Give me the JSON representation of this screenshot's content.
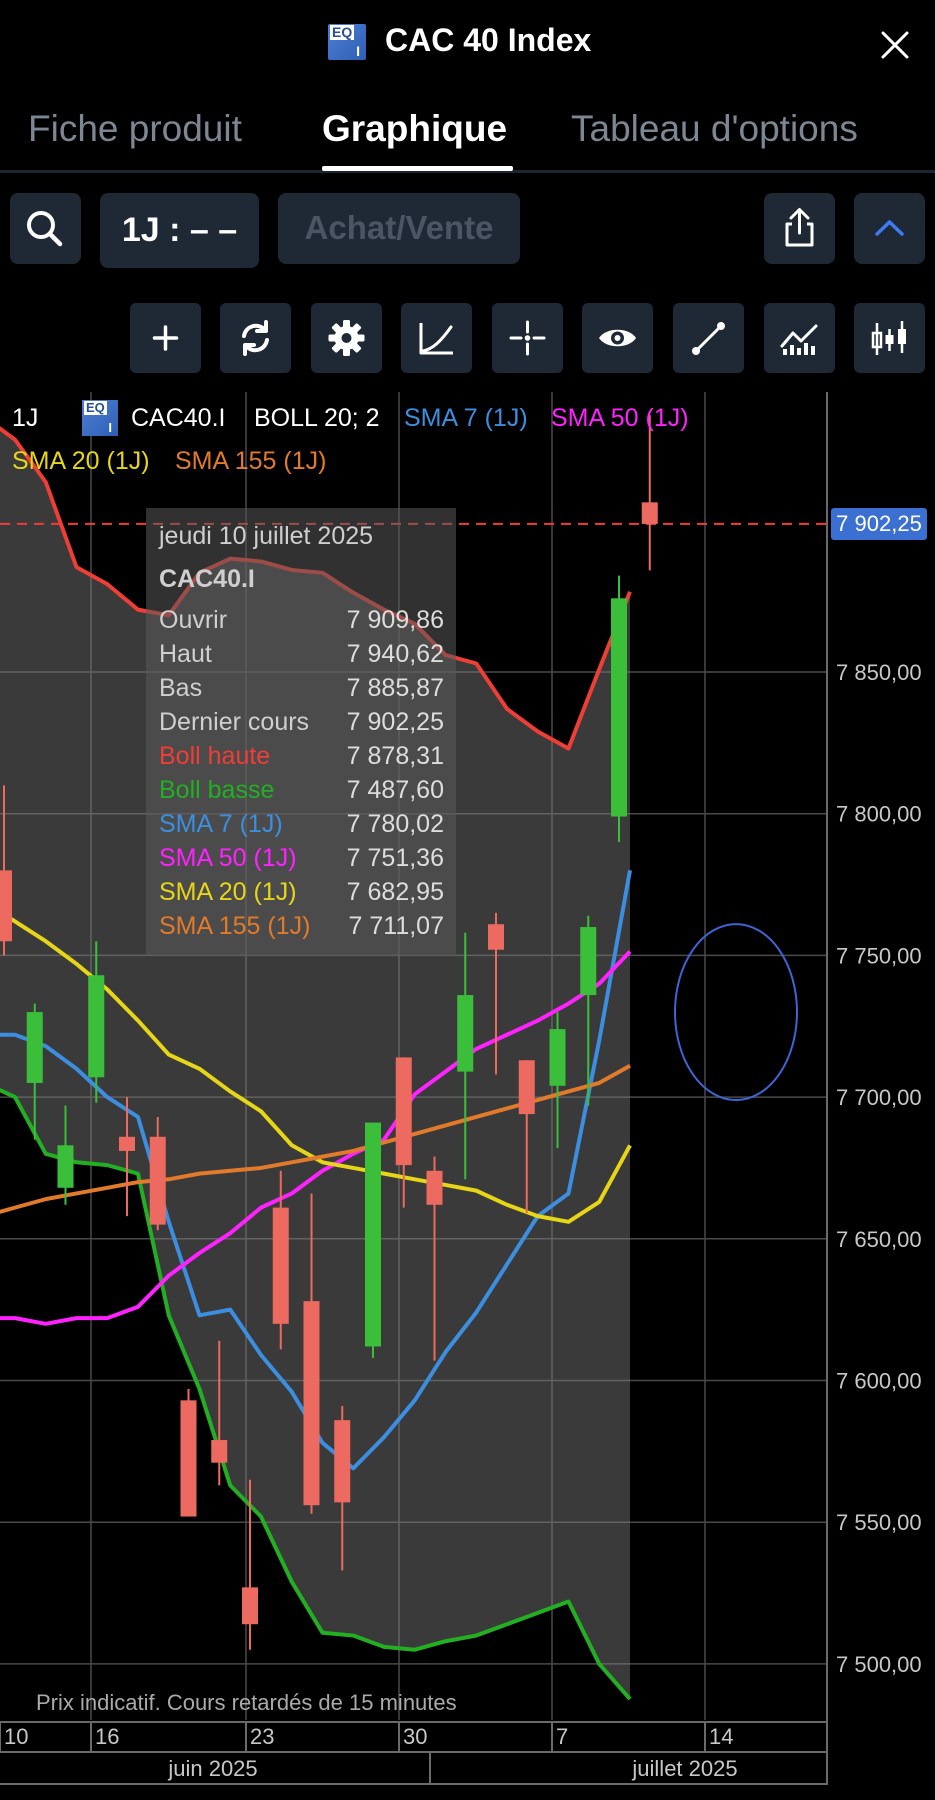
{
  "header": {
    "badge_text": "EQ I",
    "title": "CAC 40 Index"
  },
  "tabs": [
    {
      "label": "Fiche produit",
      "active": false
    },
    {
      "label": "Graphique",
      "active": true
    },
    {
      "label": "Tableau d'options",
      "active": false
    }
  ],
  "toolbar": {
    "period_label": "1J : – –",
    "trade_label": "Achat/Vente"
  },
  "tools": [
    "plus-icon",
    "refresh-icon",
    "settings-icon",
    "curve-icon",
    "crosshair-icon",
    "eye-icon",
    "line-draw-icon",
    "indicators-icon",
    "candlestick-icon"
  ],
  "legend": {
    "period": "1J",
    "symbol": "CAC40.I",
    "boll": "BOLL 20; 2",
    "sma7": "SMA 7 (1J)",
    "sma50": "SMA 50 (1J)",
    "sma20": "SMA 20 (1J)",
    "sma155": "SMA 155 (1J)"
  },
  "tooltip": {
    "date": "jeudi 10 juillet 2025",
    "symbol": "CAC40.I",
    "rows": [
      {
        "label": "Ouvrir",
        "value": "7 909,86",
        "color": "#cfcfcf"
      },
      {
        "label": "Haut",
        "value": "7 940,62",
        "color": "#cfcfcf"
      },
      {
        "label": "Bas",
        "value": "7 885,87",
        "color": "#cfcfcf"
      },
      {
        "label": "Dernier cours",
        "value": "7 902,25",
        "color": "#cfcfcf"
      },
      {
        "label": "Boll haute",
        "value": "7 878,31",
        "color": "#ef3e36"
      },
      {
        "label": "Boll basse",
        "value": "7 487,60",
        "color": "#22b022"
      },
      {
        "label": "SMA 7 (1J)",
        "value": "7 780,02",
        "color": "#3c8ee0"
      },
      {
        "label": "SMA 50 (1J)",
        "value": "7 751,36",
        "color": "#ff22ff"
      },
      {
        "label": "SMA 20 (1J)",
        "value": "7 682,95",
        "color": "#e6d617"
      },
      {
        "label": "SMA 155 (1J)",
        "value": "7 711,07",
        "color": "#e27a2b"
      }
    ]
  },
  "last_price_label": "7 902,25",
  "disclaimer": "Prix indicatif. Cours retardés de 15 minutes",
  "chart_data": {
    "type": "candlestick",
    "ylim": [
      7480,
      7970
    ],
    "y_ticks": [
      7500,
      7550,
      7600,
      7650,
      7700,
      7750,
      7800,
      7850
    ],
    "y_tick_labels": [
      "7 500,00",
      "7 550,00",
      "7 600,00",
      "7 650,00",
      "7 700,00",
      "7 750,00",
      "7 800,00",
      "7 850,00"
    ],
    "x_ticks": [
      {
        "slot": 0,
        "label": "10"
      },
      {
        "slot": 3,
        "label": "16"
      },
      {
        "slot": 8,
        "label": "23"
      },
      {
        "slot": 13,
        "label": "30"
      },
      {
        "slot": 18,
        "label": "7"
      },
      {
        "slot": 23,
        "label": "14"
      }
    ],
    "months": [
      {
        "label": "juin 2025",
        "from_slot": -0.5,
        "to_slot": 13.5
      },
      {
        "label": "juillet 2025",
        "from_slot": 13.5,
        "to_slot": 26.5
      }
    ],
    "candles": [
      {
        "slot": 0,
        "o": 7780,
        "c": 7755,
        "h": 7810,
        "l": 7750
      },
      {
        "slot": 1,
        "o": 7705,
        "c": 7730,
        "h": 7733,
        "l": 7685
      },
      {
        "slot": 2,
        "o": 7668,
        "c": 7683,
        "h": 7697,
        "l": 7662
      },
      {
        "slot": 3,
        "o": 7707,
        "c": 7743,
        "h": 7755,
        "l": 7698
      },
      {
        "slot": 4,
        "o": 7686,
        "c": 7681,
        "h": 7700,
        "l": 7658
      },
      {
        "slot": 5,
        "o": 7686,
        "c": 7655,
        "h": 7693,
        "l": 7653
      },
      {
        "slot": 6,
        "o": 7593,
        "c": 7552,
        "h": 7597,
        "l": 7552
      },
      {
        "slot": 7,
        "o": 7579,
        "c": 7571,
        "h": 7614,
        "l": 7563
      },
      {
        "slot": 8,
        "o": 7527,
        "c": 7514,
        "h": 7565,
        "l": 7505
      },
      {
        "slot": 9,
        "o": 7661,
        "c": 7620,
        "h": 7674,
        "l": 7611
      },
      {
        "slot": 10,
        "o": 7628,
        "c": 7556,
        "h": 7666,
        "l": 7553
      },
      {
        "slot": 11,
        "o": 7586,
        "c": 7557,
        "h": 7591,
        "l": 7533
      },
      {
        "slot": 12,
        "o": 7612,
        "c": 7691,
        "h": 7691,
        "l": 7608
      },
      {
        "slot": 13,
        "o": 7714,
        "c": 7676,
        "h": 7714,
        "l": 7661
      },
      {
        "slot": 14,
        "o": 7674,
        "c": 7662,
        "h": 7679,
        "l": 7607
      },
      {
        "slot": 15,
        "o": 7709,
        "c": 7736,
        "h": 7758,
        "l": 7671
      },
      {
        "slot": 16,
        "o": 7761,
        "c": 7752,
        "h": 7765,
        "l": 7708
      },
      {
        "slot": 17,
        "o": 7713,
        "c": 7694,
        "h": 7713,
        "l": 7659
      },
      {
        "slot": 18,
        "o": 7704,
        "c": 7724,
        "h": 7730,
        "l": 7682
      },
      {
        "slot": 19,
        "o": 7736,
        "c": 7760,
        "h": 7764,
        "l": 7697
      },
      {
        "slot": 20,
        "o": 7799,
        "c": 7876,
        "h": 7884,
        "l": 7790
      },
      {
        "slot": 21,
        "o": 7909.86,
        "c": 7902.25,
        "h": 7940.62,
        "l": 7885.87
      }
    ],
    "series": [
      {
        "name": "Boll haute",
        "color": "#ef3e36",
        "slot0": -1,
        "values": [
          7940,
          7932,
          7917,
          7887,
          7881,
          7872,
          7870,
          7885,
          7890,
          7889,
          7886,
          7885,
          7878,
          7872,
          7867,
          7856,
          7853,
          7837,
          7829,
          7823,
          7851,
          7878.31
        ]
      },
      {
        "name": "Boll basse",
        "color": "#22b022",
        "slot0": -1,
        "values": [
          7705,
          7700,
          7680,
          7677,
          7676,
          7673,
          7623,
          7597,
          7563,
          7552,
          7529,
          7511,
          7510,
          7506,
          7505,
          7508,
          7510,
          7514,
          7518,
          7522,
          7500,
          7487.6
        ]
      },
      {
        "name": "SMA 7 (1J)",
        "color": "#3c8ee0",
        "slot0": -1,
        "values": [
          7722,
          7722,
          7718,
          7710,
          7700,
          7693,
          7656,
          7623,
          7625,
          7609,
          7596,
          7578,
          7569,
          7580,
          7593,
          7610,
          7624,
          7641,
          7658,
          7666,
          7720,
          7780.02
        ]
      },
      {
        "name": "SMA 50 (1J)",
        "color": "#ff22ff",
        "slot0": -1,
        "values": [
          7622,
          7622,
          7620,
          7622,
          7622,
          7626,
          7637,
          7645,
          7652,
          7661,
          7666,
          7674,
          7680,
          7685,
          7701,
          7709,
          7717,
          7722,
          7727,
          7733,
          7740,
          7751.36
        ]
      },
      {
        "name": "SMA 20 (1J)",
        "color": "#e6d617",
        "slot0": -1,
        "values": [
          7769,
          7762,
          7755,
          7747,
          7738,
          7727,
          7715,
          7710,
          7702,
          7695,
          7683,
          7677,
          7675,
          7673,
          7671,
          7669,
          7667,
          7662,
          7658,
          7656,
          7663,
          7682.95
        ]
      },
      {
        "name": "SMA 155 (1J)",
        "color": "#e27a2b",
        "slot0": -1,
        "values": [
          7658,
          7661,
          7664,
          7666,
          7668,
          7670,
          7671,
          7673,
          7674,
          7675,
          7677,
          7679,
          7681,
          7684,
          7687,
          7690,
          7693,
          7696,
          7699,
          7702,
          7705,
          7711.07
        ]
      }
    ],
    "last_price": 7902.25,
    "annotation": {
      "type": "ellipse",
      "color": "#3e64d6",
      "slot": 23.9,
      "y": 7730
    }
  }
}
